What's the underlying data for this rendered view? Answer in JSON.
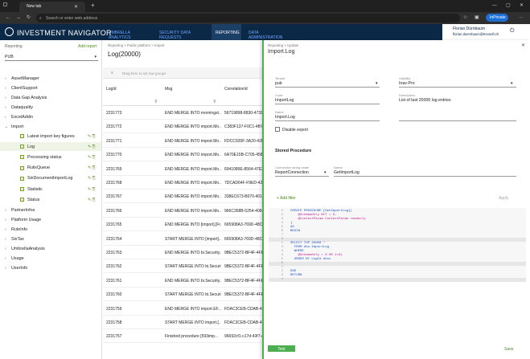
{
  "browser": {
    "tab_title": "New tab",
    "address_placeholder": "Search or enter web address",
    "profile_label": "InPrivate"
  },
  "app": {
    "name": "INVESTMENT NAVIGATOR",
    "nav": [
      "UMBRELLA ANALYTICS",
      "SECURITY DATA REQUESTS",
      "REPORTING",
      "DATA ADMINISTRATION"
    ],
    "active_nav": 2,
    "user_name": "Florian Dürnbaum",
    "user_email": "florian.duernbaum@trexsoft.ch"
  },
  "left": {
    "section_label": "Reporting",
    "add_report": "Add report",
    "selector": "PUB",
    "tree": [
      {
        "label": "AssetManager",
        "level": 0
      },
      {
        "label": "ClientSupport",
        "level": 0
      },
      {
        "label": "Data Gap Analysis",
        "level": 0
      },
      {
        "label": "Dataquality",
        "level": 0
      },
      {
        "label": "ExcelAddin",
        "level": 0
      },
      {
        "label": "Import",
        "level": 0,
        "open": true
      },
      {
        "label": "Latest import key figures",
        "level": 1
      },
      {
        "label": "Log",
        "level": 1,
        "selected": true
      },
      {
        "label": "Processing status",
        "level": 1
      },
      {
        "label": "RulixQueue",
        "level": 1
      },
      {
        "label": "SixDocumentImportLog",
        "level": 1
      },
      {
        "label": "Statistic",
        "level": 1
      },
      {
        "label": "Status",
        "level": 1
      },
      {
        "label": "PartnerInfos",
        "level": 0
      },
      {
        "label": "Platform Usage",
        "level": 0
      },
      {
        "label": "RuleInfo",
        "level": 0
      },
      {
        "label": "SixTax",
        "level": 0
      },
      {
        "label": "UmbrellaAnalysis",
        "level": 0
      },
      {
        "label": "Usage",
        "level": 0
      },
      {
        "label": "UserInfo",
        "level": 0
      }
    ]
  },
  "grid": {
    "breadcrumb": "Reporting  >  Public platform  >  Import",
    "title": "Log(20000)",
    "group_hint": "Drag here to set row groups",
    "columns": [
      "LogId",
      "Msg",
      "CorrelationId"
    ],
    "rows": [
      [
        "2231773",
        "END MERGE INTO morningst...",
        "56719898-8830-4739"
      ],
      [
        "2231772",
        "END MERGE INTO import.Mo...",
        "C383F137-F0C1-4B7E"
      ],
      [
        "2231771",
        "END MERGE INTO import.Mo...",
        "FDCC935F-3A20-42DE"
      ],
      [
        "2231770",
        "END MERGE INTO import.Mo...",
        "6A70E15B-C705-4586"
      ],
      [
        "2231769",
        "END MERGE INTO import.Mo...",
        "6941089E-8564-47E3"
      ],
      [
        "2231768",
        "END MERGE INTO import.Mo...",
        "7DCAD64F-F9ED-42E1"
      ],
      [
        "2231767",
        "END MERGE INTO import.Mo...",
        "338EC673-B070-4019"
      ],
      [
        "2231766",
        "END MERGE INTO import.Mo...",
        "966C358B-5254-406C"
      ],
      [
        "2231765",
        "END MERGE INTO [import].[Fr...",
        "665908A3-769D-48C3"
      ],
      [
        "2231764",
        "START MERGE INTO [import]...",
        "665908A3-769D-48C3"
      ],
      [
        "2231763",
        "END MERGE INTO bi.Security...",
        "9BEC5372-BF4F-4FEF"
      ],
      [
        "2231762",
        "START MERGE INTO bi.Securi...",
        "9BEC5372-BF4F-4FEF"
      ],
      [
        "2231761",
        "END MERGE INTO bi.Security...",
        "9BEC5372-BF4F-4FEF"
      ],
      [
        "2231760",
        "START MERGE INTO bi.Securi...",
        "9BEC5372-BF4F-4FEF"
      ],
      [
        "2231759",
        "END MERGE INTO import.EF...",
        "FDAC3CEB-CDAB-4E0"
      ],
      [
        "2231758",
        "START MERGE INTO import.[...",
        "FDAC3CEB-CDAB-4E0"
      ],
      [
        "2231757",
        "Finished procedure [593imp...",
        "96692cf1-c17d-43f7-a"
      ]
    ]
  },
  "pane": {
    "breadcrumb": "Reporting  >  Update",
    "title": "Import.Log",
    "tenant_label": "Tenant",
    "tenant": "pub",
    "visibility_label": "Visibility",
    "visibility": "Inav-Pro",
    "code_label": "Code",
    "code": "ImportLog",
    "desc_label": "Description",
    "desc": "List of last 20000 log entries",
    "name_label": "Name",
    "name": "Import.Log",
    "disable_export": "Disable export",
    "sp_header": "Stored Procedure",
    "conn_label": "Connection string name",
    "conn": "ReportConnection",
    "sp_name_label": "Name",
    "sp_name": "GetImportLog",
    "add_filter": "+ Add filter",
    "apply": "Apply",
    "code_lines": [
      {
        "n": "1",
        "t": "CREATE PROCEDURE [GetImportLog]("
      },
      {
        "n": "2",
        "t": "    @SchemaOnly BIT = 0,"
      },
      {
        "n": "3",
        "t": "    @ContextParam ContextParam readonly"
      },
      {
        "n": "4",
        "t": ")"
      },
      {
        "n": "5",
        "t": "AS"
      },
      {
        "n": "6",
        "t": "BEGIN"
      },
      {
        "n": "7",
        "t": ""
      },
      {
        "n": "8",
        "t": ""
      },
      {
        "n": "1",
        "t": "SELECT TOP 20000 *"
      },
      {
        "n": "2",
        "t": "  FROM dbo.ImportLog"
      },
      {
        "n": "3",
        "t": "  WHERE"
      },
      {
        "n": "4",
        "t": "    @SchemaOnly = 0 OR 1=0)"
      },
      {
        "n": "5",
        "t": "  ORDER BY LogId desc"
      },
      {
        "n": "6",
        "t": ""
      },
      {
        "n": "1",
        "t": ""
      },
      {
        "n": "2",
        "t": "END"
      },
      {
        "n": "3",
        "t": "RETURN"
      },
      {
        "n": "4",
        "t": ""
      }
    ],
    "test": "Test",
    "save": "Save"
  }
}
